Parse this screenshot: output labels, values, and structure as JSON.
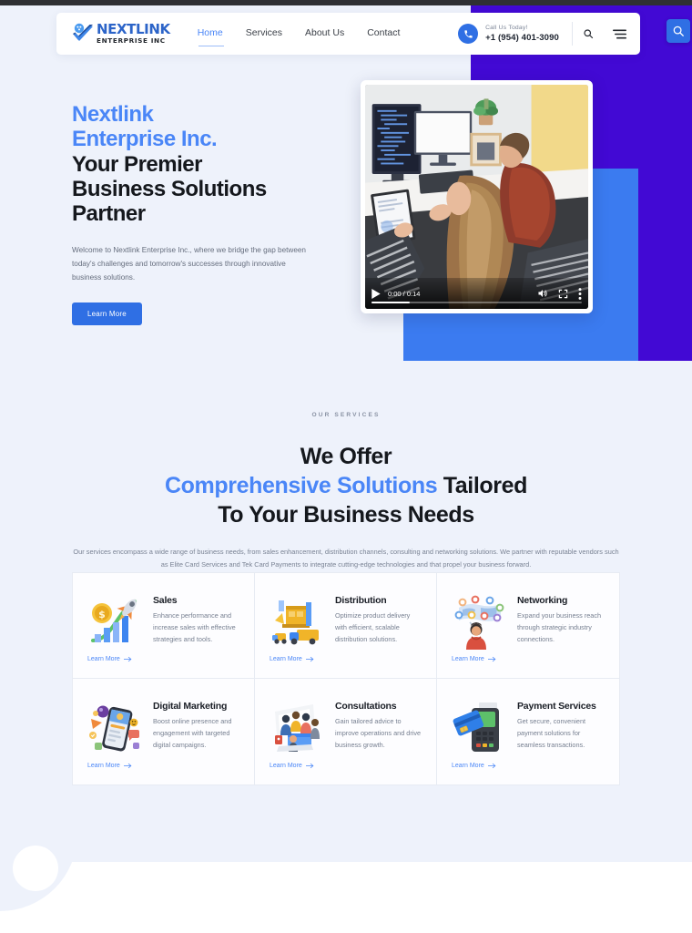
{
  "colors": {
    "accent_blue": "#4a86f7",
    "button_blue": "#2f6fe4",
    "deep_purple": "#4209d4",
    "mid_blue": "#3b7bf0",
    "page_bg": "#eef2fb",
    "text_dark": "#15181d",
    "text_muted": "#767f90"
  },
  "header": {
    "logo": {
      "line1": "NEXTLINK",
      "line2": "ENTERPRISE INC",
      "icon": "check-person-logo-icon"
    },
    "nav": [
      {
        "label": "Home",
        "active": true
      },
      {
        "label": "Services",
        "active": false
      },
      {
        "label": "About Us",
        "active": false
      },
      {
        "label": "Contact",
        "active": false
      }
    ],
    "call": {
      "icon": "phone-icon",
      "label": "Call Us Today!",
      "number": "+1 (954) 401-3090"
    },
    "search_icon": "search-icon",
    "menu_icon": "hamburger-menu-icon"
  },
  "floating_search": {
    "icon": "search-magnifier-icon"
  },
  "hero": {
    "title_accent_line1": "Nextlink",
    "title_accent_line2": "Enterprise Inc.",
    "title_line3": "Your Premier",
    "title_line4": "Business Solutions",
    "title_line5": "Partner",
    "paragraph": "Welcome to Nextlink Enterprise Inc., where we bridge the gap between today's challenges and tomorrow's successes through innovative business solutions.",
    "cta_label": "Learn More"
  },
  "video": {
    "time_display": "0:00 / 0:14",
    "play_icon": "play-icon",
    "volume_icon": "volume-icon",
    "fullscreen_icon": "fullscreen-icon",
    "more_icon": "more-options-icon",
    "progress_percent": 18
  },
  "services": {
    "eyebrow": "OUR SERVICES",
    "heading_line1": "We Offer",
    "heading_accent": "Comprehensive Solutions",
    "heading_line2_rest": " Tailored",
    "heading_line3": "To Your Business Needs",
    "paragraph": "Our services encompass a wide range of business needs, from sales enhancement, distribution channels, consulting and networking solutions. We partner with reputable vendors such as Elite Card Services and Tek Card Payments to integrate cutting-edge technologies and that propel your business forward.",
    "link_label": "Learn More",
    "cards": [
      {
        "icon": "sales-growth-rocket-icon",
        "title": "Sales",
        "desc": "Enhance performance and increase sales with effective strategies and tools.",
        "link": "Learn More"
      },
      {
        "icon": "distribution-truck-warehouse-icon",
        "title": "Distribution",
        "desc": "Optimize product delivery with efficient, scalable distribution solutions.",
        "link": "Learn More"
      },
      {
        "icon": "networking-people-globe-icon",
        "title": "Networking",
        "desc": "Expand your business reach through strategic industry connections.",
        "link": "Learn More"
      },
      {
        "icon": "digital-marketing-phone-icon",
        "title": "Digital Marketing",
        "desc": "Boost online presence and engagement with targeted digital campaigns.",
        "link": "Learn More"
      },
      {
        "icon": "consultations-meeting-icon",
        "title": "Consultations",
        "desc": "Gain tailored advice to improve operations and drive business growth.",
        "link": "Learn More"
      },
      {
        "icon": "payment-terminal-card-icon",
        "title": "Payment Services",
        "desc": "Get secure, convenient payment solutions for seamless transactions.",
        "link": "Learn More"
      }
    ]
  }
}
